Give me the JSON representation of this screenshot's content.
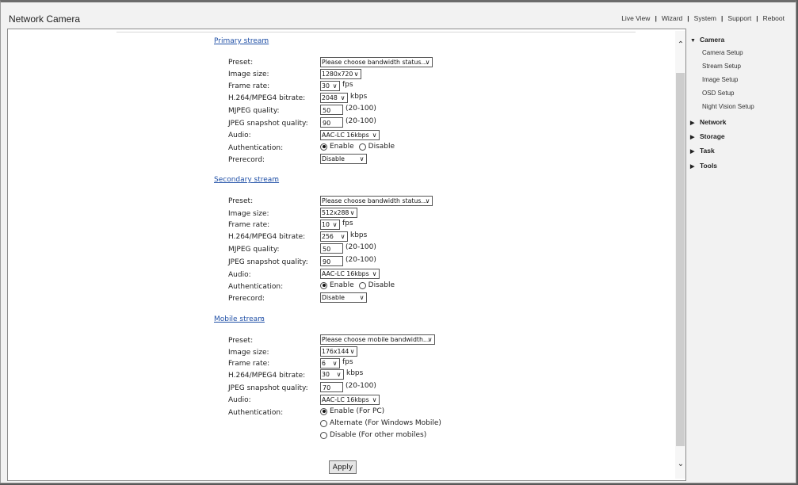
{
  "header": {
    "title": "Network Camera",
    "nav": [
      "Live View",
      "Wizard",
      "System",
      "Support",
      "Reboot"
    ],
    "separator": "|"
  },
  "streams": {
    "primary": {
      "heading": "Primary stream",
      "preset": "Please choose bandwidth status...",
      "image_size": "1280x720",
      "frame_rate": "30",
      "bitrate": "2048",
      "mjpeg_quality": "50",
      "jpeg_quality": "90",
      "audio": "AAC-LC 16kbps",
      "authentication": "Enable",
      "prerecord": "Disable"
    },
    "secondary": {
      "heading": "Secondary stream",
      "preset": "Please choose bandwidth status...",
      "image_size": "512x288",
      "frame_rate": "10",
      "bitrate": "256",
      "mjpeg_quality": "50",
      "jpeg_quality": "90",
      "audio": "AAC-LC 16kbps",
      "authentication": "Enable",
      "prerecord": "Disable"
    },
    "mobile": {
      "heading": "Mobile stream",
      "preset": "Please choose mobile bandwidth...",
      "image_size": "176x144",
      "frame_rate": "6",
      "bitrate": "30",
      "jpeg_quality": "70",
      "audio": "AAC-LC 16kbps",
      "auth_options": [
        "Enable (For PC)",
        "Alternate (For Windows Mobile)",
        "Disable (For other mobiles)"
      ],
      "auth_selected": 0
    }
  },
  "labels": {
    "colon": ":",
    "preset": "Preset:",
    "image_size": "Image size:",
    "frame_rate": "Frame rate:",
    "bitrate": "H.264/MPEG4 bitrate:",
    "mjpeg_quality": "MJPEG quality:",
    "jpeg_quality": "JPEG snapshot quality:",
    "audio": "Audio:",
    "authentication": "Authentication:",
    "prerecord": "Prerecord:",
    "fps": "fps",
    "kbps": "kbps",
    "quality_range": "(20-100)",
    "enable": "Enable",
    "disable": "Disable"
  },
  "apply_label": "Apply",
  "sidebar": {
    "sections": [
      {
        "label": "Camera",
        "expanded": true,
        "items": [
          "Camera Setup",
          "Stream Setup",
          "Image Setup",
          "OSD Setup",
          "Night Vision Setup"
        ]
      },
      {
        "label": "Network",
        "expanded": false
      },
      {
        "label": "Storage",
        "expanded": false
      },
      {
        "label": "Task",
        "expanded": false
      },
      {
        "label": "Tools",
        "expanded": false
      }
    ]
  },
  "icons": {
    "scroll_up": "chevron-up-icon",
    "scroll_down": "chevron-down-icon",
    "expanded": "triangle-down-icon",
    "collapsed": "triangle-right-icon"
  }
}
